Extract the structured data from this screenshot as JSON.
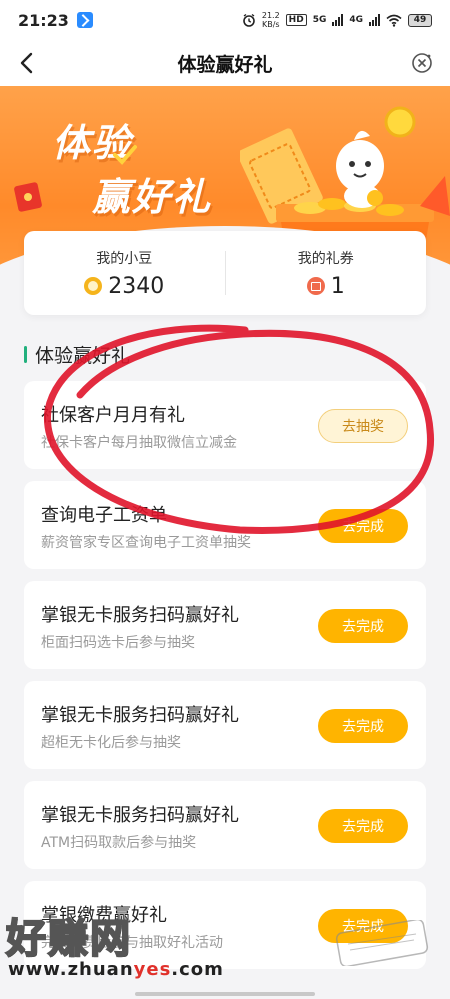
{
  "status_bar": {
    "time": "21:23",
    "speed_value": "21.2",
    "speed_unit": "KB/s",
    "hd_label": "HD",
    "net1": "5G",
    "net2": "4G",
    "battery": "49"
  },
  "nav": {
    "title": "体验赢好礼"
  },
  "banner": {
    "line1": "体验",
    "line2": "赢好礼"
  },
  "points": {
    "beans_label": "我的小豆",
    "beans_value": "2340",
    "coupons_label": "我的礼券",
    "coupons_value": "1"
  },
  "section": {
    "title": "体验赢好礼"
  },
  "tasks": [
    {
      "title": "社保客户月月有礼",
      "desc": "社保卡客户每月抽取微信立减金",
      "button": "去抽奖"
    },
    {
      "title": "查询电子工资单",
      "desc": "薪资管家专区查询电子工资单抽奖",
      "button": "去完成"
    },
    {
      "title": "掌银无卡服务扫码赢好礼",
      "desc": "柜面扫码选卡后参与抽奖",
      "button": "去完成"
    },
    {
      "title": "掌银无卡服务扫码赢好礼",
      "desc": "超柜无卡化后参与抽奖",
      "button": "去完成"
    },
    {
      "title": "掌银无卡服务扫码赢好礼",
      "desc": "ATM扫码取款后参与抽奖",
      "button": "去完成"
    },
    {
      "title": "掌银缴费赢好礼",
      "desc": "完成缴费后参与抽取好礼活动",
      "button": "去完成"
    }
  ],
  "watermark": {
    "brand": "好赚网",
    "url_prefix": "www.zhuan",
    "url_highlight": "yes",
    "url_suffix": ".com"
  },
  "colors": {
    "accent_green": "#22b07d",
    "orange_banner": "#ff8a2a",
    "button_yellow": "#ffb400",
    "annotation_red": "#e0142a"
  }
}
